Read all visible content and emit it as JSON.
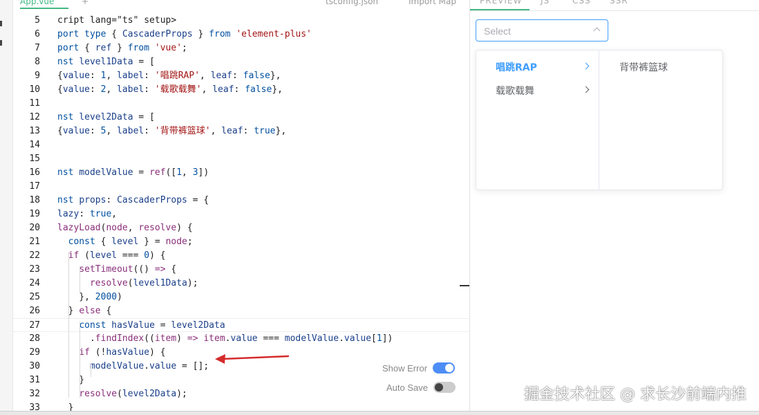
{
  "editor": {
    "tabs": [
      {
        "label": "App.vue",
        "active": true
      },
      {
        "label": "+",
        "active": false
      },
      {
        "label": "tsconfig.json",
        "active": false
      },
      {
        "label": "Import Map",
        "active": false
      }
    ],
    "lines": [
      {
        "no": "5",
        "tokens": [
          [
            "p",
            "cript lang=\"ts\" setup>"
          ]
        ]
      },
      {
        "no": "6",
        "tokens": [
          [
            "kw",
            "port type "
          ],
          [
            "p",
            "{ "
          ],
          [
            "var",
            "CascaderProps"
          ],
          [
            "p",
            " } "
          ],
          [
            "kw",
            "from "
          ],
          [
            "str",
            "'element-plus'"
          ]
        ]
      },
      {
        "no": "7",
        "tokens": [
          [
            "kw",
            "port "
          ],
          [
            "p",
            "{ "
          ],
          [
            "var",
            "ref"
          ],
          [
            "p",
            " } "
          ],
          [
            "kw",
            "from "
          ],
          [
            "str",
            "'vue'"
          ],
          [
            "p",
            ";"
          ]
        ]
      },
      {
        "no": "8",
        "tokens": [
          [
            "kw",
            "nst "
          ],
          [
            "var",
            "level1Data"
          ],
          [
            "p",
            " = ["
          ]
        ]
      },
      {
        "no": "9",
        "tokens": [
          [
            "p",
            "{"
          ],
          [
            "var",
            "value"
          ],
          [
            "p",
            ": "
          ],
          [
            "num",
            "1"
          ],
          [
            "p",
            ", "
          ],
          [
            "var",
            "label"
          ],
          [
            "p",
            ": "
          ],
          [
            "str",
            "'唱跳RAP'"
          ],
          [
            "p",
            ", "
          ],
          [
            "var",
            "leaf"
          ],
          [
            "p",
            ": "
          ],
          [
            "kw",
            "false"
          ],
          [
            "p",
            "},"
          ]
        ]
      },
      {
        "no": "10",
        "tokens": [
          [
            "p",
            "{"
          ],
          [
            "var",
            "value"
          ],
          [
            "p",
            ": "
          ],
          [
            "num",
            "2"
          ],
          [
            "p",
            ", "
          ],
          [
            "var",
            "label"
          ],
          [
            "p",
            ": "
          ],
          [
            "str",
            "'载歌载舞'"
          ],
          [
            "p",
            ", "
          ],
          [
            "var",
            "leaf"
          ],
          [
            "p",
            ": "
          ],
          [
            "kw",
            "false"
          ],
          [
            "p",
            "},"
          ]
        ]
      },
      {
        "no": "11",
        "tokens": []
      },
      {
        "no": "12",
        "tokens": [
          [
            "kw",
            "nst "
          ],
          [
            "var",
            "level2Data"
          ],
          [
            "p",
            " = ["
          ]
        ]
      },
      {
        "no": "13",
        "tokens": [
          [
            "p",
            "{"
          ],
          [
            "var",
            "value"
          ],
          [
            "p",
            ": "
          ],
          [
            "num",
            "5"
          ],
          [
            "p",
            ", "
          ],
          [
            "var",
            "label"
          ],
          [
            "p",
            ": "
          ],
          [
            "str",
            "'背带裤篮球'"
          ],
          [
            "p",
            ", "
          ],
          [
            "var",
            "leaf"
          ],
          [
            "p",
            ": "
          ],
          [
            "kw",
            "true"
          ],
          [
            "p",
            "},"
          ]
        ]
      },
      {
        "no": "14",
        "tokens": []
      },
      {
        "no": "15",
        "tokens": []
      },
      {
        "no": "16",
        "tokens": [
          [
            "kw",
            "nst "
          ],
          [
            "var",
            "modelValue"
          ],
          [
            "p",
            " = "
          ],
          [
            "fn",
            "ref"
          ],
          [
            "p",
            "(["
          ],
          [
            "num",
            "1"
          ],
          [
            "p",
            ", "
          ],
          [
            "num",
            "3"
          ],
          [
            "p",
            "])"
          ]
        ]
      },
      {
        "no": "17",
        "tokens": []
      },
      {
        "no": "18",
        "tokens": [
          [
            "kw",
            "nst "
          ],
          [
            "var",
            "props"
          ],
          [
            "p",
            ": "
          ],
          [
            "var",
            "CascaderProps"
          ],
          [
            "p",
            " = {"
          ]
        ]
      },
      {
        "no": "19",
        "tokens": [
          [
            "var",
            "lazy"
          ],
          [
            "p",
            ": "
          ],
          [
            "kw",
            "true"
          ],
          [
            "p",
            ","
          ]
        ]
      },
      {
        "no": "20",
        "tokens": [
          [
            "fn",
            "lazyLoad"
          ],
          [
            "p",
            "("
          ],
          [
            "fn",
            "node"
          ],
          [
            "p",
            ", "
          ],
          [
            "fn",
            "resolve"
          ],
          [
            "p",
            ") {"
          ]
        ]
      },
      {
        "no": "21",
        "tokens": [
          [
            "p",
            "  "
          ],
          [
            "kw",
            "const "
          ],
          [
            "p",
            "{ "
          ],
          [
            "var",
            "level"
          ],
          [
            "p",
            " } = "
          ],
          [
            "fn",
            "node"
          ],
          [
            "p",
            ";"
          ]
        ]
      },
      {
        "no": "22",
        "tokens": [
          [
            "p",
            "  "
          ],
          [
            "fn",
            "if "
          ],
          [
            "p",
            "("
          ],
          [
            "var",
            "level"
          ],
          [
            "p",
            " === "
          ],
          [
            "num",
            "0"
          ],
          [
            "p",
            ") {"
          ]
        ]
      },
      {
        "no": "23",
        "tokens": [
          [
            "p",
            "    "
          ],
          [
            "fn",
            "setTimeout"
          ],
          [
            "p",
            "(() "
          ],
          [
            "fn",
            "=>"
          ],
          [
            "p",
            " {"
          ]
        ]
      },
      {
        "no": "24",
        "tokens": [
          [
            "p",
            "      "
          ],
          [
            "fn",
            "resolve"
          ],
          [
            "p",
            "("
          ],
          [
            "var",
            "level1Data"
          ],
          [
            "p",
            ");"
          ]
        ]
      },
      {
        "no": "25",
        "tokens": [
          [
            "p",
            "    }, "
          ],
          [
            "num",
            "2000"
          ],
          [
            "p",
            ")"
          ]
        ]
      },
      {
        "no": "26",
        "tokens": [
          [
            "p",
            "  } "
          ],
          [
            "fn",
            "else"
          ],
          [
            "p",
            " {"
          ]
        ]
      },
      {
        "no": "27",
        "tokens": [
          [
            "p",
            "    "
          ],
          [
            "kw",
            "const "
          ],
          [
            "var",
            "hasValue"
          ],
          [
            "p",
            " = "
          ],
          [
            "var",
            "level2Data"
          ]
        ]
      },
      {
        "no": "28",
        "tokens": [
          [
            "p",
            "      ."
          ],
          [
            "fn",
            "findIndex"
          ],
          [
            "p",
            "(("
          ],
          [
            "fn",
            "item"
          ],
          [
            "p",
            ") "
          ],
          [
            "fn",
            "=>"
          ],
          [
            "p",
            " "
          ],
          [
            "fn",
            "item"
          ],
          [
            "p",
            "."
          ],
          [
            "var",
            "value"
          ],
          [
            "p",
            " === "
          ],
          [
            "var",
            "modelValue"
          ],
          [
            "p",
            "."
          ],
          [
            "var",
            "value"
          ],
          [
            "p",
            "["
          ],
          [
            "num",
            "1"
          ],
          [
            "p",
            "])"
          ]
        ]
      },
      {
        "no": "29",
        "tokens": [
          [
            "p",
            "    "
          ],
          [
            "fn",
            "if "
          ],
          [
            "p",
            "(!"
          ],
          [
            "var",
            "hasValue"
          ],
          [
            "p",
            ") {"
          ]
        ]
      },
      {
        "no": "30",
        "tokens": [
          [
            "p",
            "      "
          ],
          [
            "var",
            "modelValue"
          ],
          [
            "p",
            "."
          ],
          [
            "var",
            "value"
          ],
          [
            "p",
            " = [];"
          ]
        ]
      },
      {
        "no": "31",
        "tokens": [
          [
            "p",
            "    }"
          ]
        ]
      },
      {
        "no": "32",
        "tokens": [
          [
            "p",
            "    "
          ],
          [
            "fn",
            "resolve"
          ],
          [
            "p",
            "("
          ],
          [
            "var",
            "level2Data"
          ],
          [
            "p",
            ");"
          ]
        ]
      },
      {
        "no": "33",
        "tokens": [
          [
            "p",
            "  }"
          ]
        ]
      }
    ],
    "active_line": "27",
    "toggles": {
      "show_error": {
        "label": "Show Error",
        "on": true
      },
      "auto_save": {
        "label": "Auto Save",
        "on": false
      }
    },
    "annotation_arrow_color": "#d42b2b"
  },
  "preview": {
    "tabs": [
      "PREVIEW",
      "JS",
      "CSS",
      "SSR"
    ],
    "cascader": {
      "placeholder": "Select",
      "level1": [
        {
          "label": "唱跳RAP",
          "active": true
        },
        {
          "label": "载歌载舞",
          "active": false
        }
      ],
      "level2": [
        {
          "label": "背带裤篮球"
        }
      ]
    }
  },
  "watermark": "掘金技术社区 @ 求长沙前端内推",
  "colors": {
    "accent": "#409eff",
    "vue_green": "#42b883",
    "toggle_on": "#4d8ef6"
  }
}
